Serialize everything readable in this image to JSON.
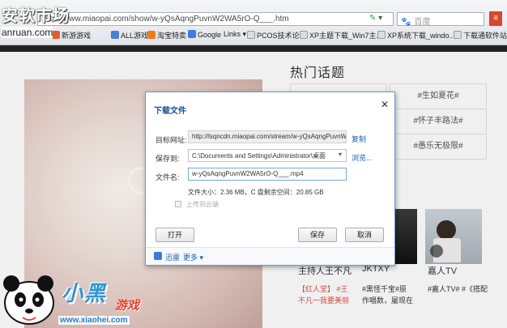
{
  "browser": {
    "address": "http://www.miaopai.com/show/w-yQsAqngPuvnW2WA5rO-Q___.htm",
    "search_placeholder": "百度",
    "bookmarks": [
      "新游游戏",
      "ALL游戏",
      "淘宝特卖",
      "Google",
      "Links",
      "PCOS技术论坛",
      "XP主题下载_Win7主...",
      "XP系统下载_windo...",
      "下载通软件站"
    ]
  },
  "watermarks": {
    "top_left": "安软市场",
    "top_left_url": "anruan.com",
    "brand": "小黑",
    "brand_sub": "游戏",
    "brand_url": "www.xiaohei.com"
  },
  "page": {
    "topics_title": "热门话题",
    "topics": [
      "#生如夏花#",
      "#怀子丰路法#",
      "#愚乐无极限#"
    ],
    "thumbs": [
      "主持人王不凡",
      "JKTXY",
      "嘉人TV"
    ],
    "descs": [
      {
        "red": "【红人堂】",
        "red2": "#王",
        "text": "不凡一我要美丽"
      },
      {
        "text": "#黑怪千宝#原",
        "text2": "作唱数，屡现在"
      },
      {
        "text": "#嘉人TV# #《搭配"
      }
    ]
  },
  "dialog": {
    "title": "下载文件",
    "target_label": "目标网址:",
    "target_value": "http://lsqncdn.miaopai.com/stream/w-yQsAqngPuvnW2WA5rO-Q___.mp4",
    "copy_link": "复制",
    "save_label": "保存到:",
    "save_value": "C:\\Documents and Settings\\Administrator\\桌面",
    "browse_link": "浏览...",
    "filename_label": "文件名:",
    "filename_value": "w-yQsAqngPuvnW2WA5rO-Q___.mp4",
    "size_info": "文件大小：2.36 MB，C 盘剩余空间：20.85 GB",
    "upload_cloud": "上传到云端",
    "open_button": "打开",
    "save_button": "保存",
    "cancel_button": "取消",
    "footer_link1": "迅雷",
    "footer_link2": "更多"
  }
}
